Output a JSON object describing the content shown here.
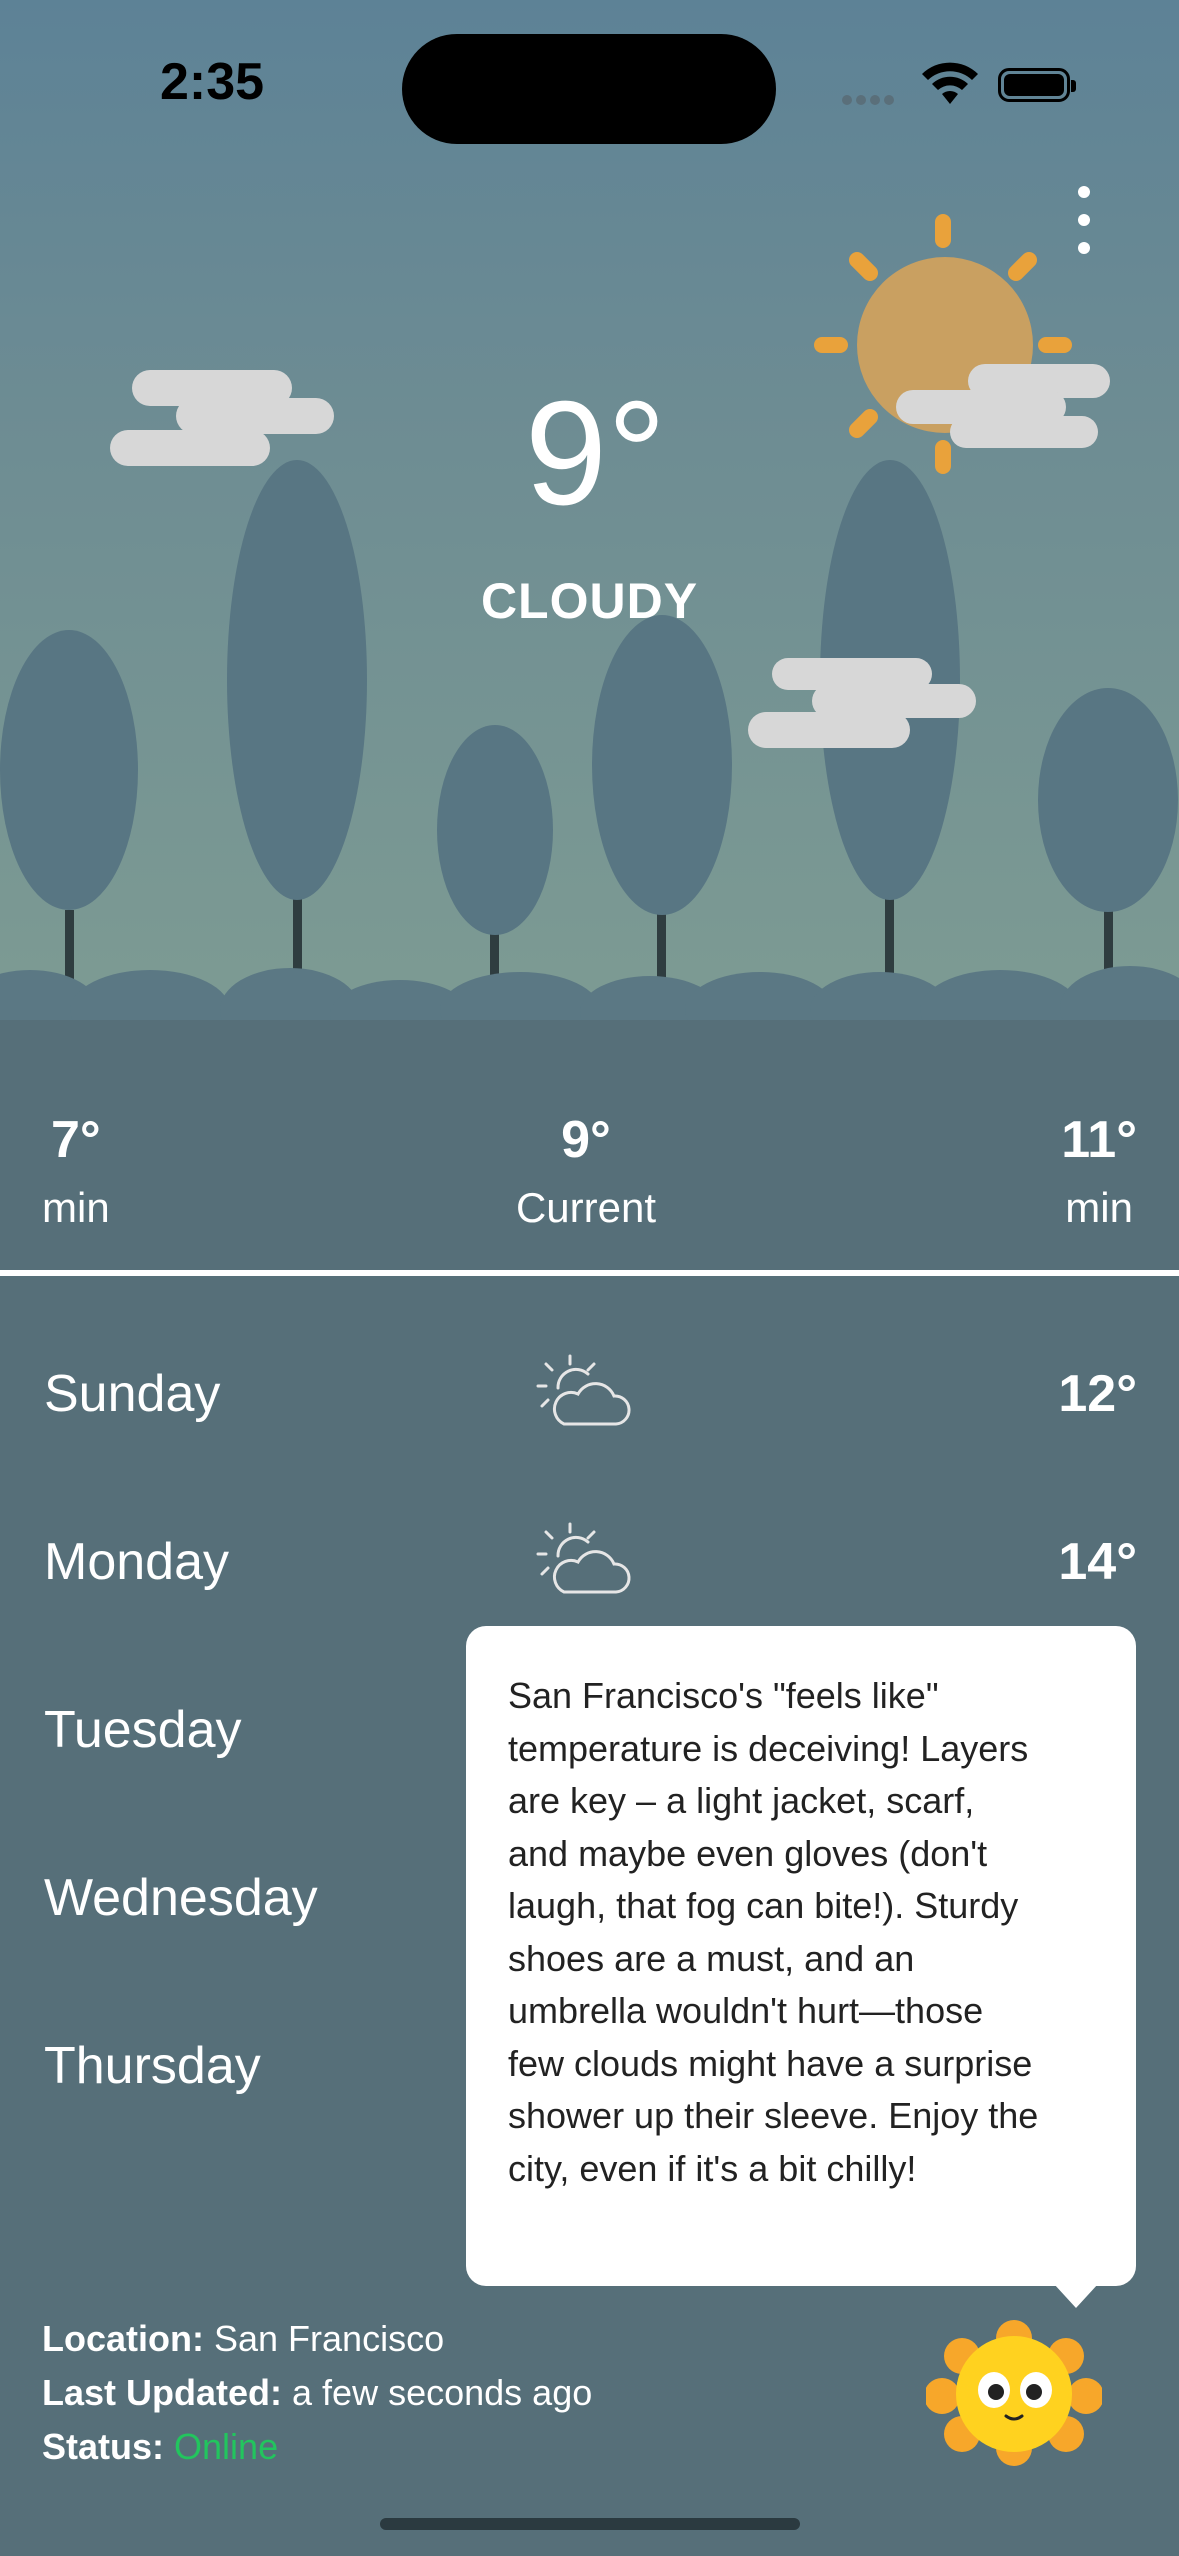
{
  "status_bar": {
    "time": "2:35"
  },
  "current": {
    "temperature": "9°",
    "condition": "CLOUDY"
  },
  "summary": [
    {
      "value": "7°",
      "label": "min"
    },
    {
      "value": "9°",
      "label": "Current"
    },
    {
      "value": "11°",
      "label": "min"
    }
  ],
  "forecast": [
    {
      "day": "Sunday",
      "icon": "partly-cloudy-icon",
      "temp": "12°"
    },
    {
      "day": "Monday",
      "icon": "partly-cloudy-icon",
      "temp": "14°"
    },
    {
      "day": "Tuesday"
    },
    {
      "day": "Wednesday"
    },
    {
      "day": "Thursday"
    }
  ],
  "tip": {
    "lines": [
      "San Francisco's \"feels like\"",
      "temperature is deceiving!  Layers",
      "are key –  a light jacket, scarf,",
      "and maybe even gloves (don't",
      "laugh, that fog can bite!).  Sturdy",
      "shoes are a must, and an",
      "umbrella wouldn't hurt—those",
      "few clouds might have a surprise",
      "shower up their sleeve.  Enjoy the",
      "city, even if it's a bit chilly!"
    ]
  },
  "info": {
    "location_label": "Location:",
    "location_value": "San Francisco",
    "updated_label": "Last Updated:",
    "updated_value": "a few seconds ago",
    "status_label": "Status:",
    "status_value": "Online"
  },
  "colors": {
    "status_online": "#22c55e",
    "sun": "#f2a634",
    "mascot": "#ffd21f"
  }
}
